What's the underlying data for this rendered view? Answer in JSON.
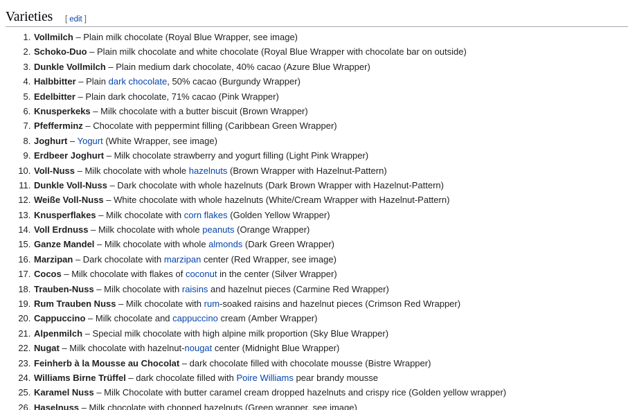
{
  "section": {
    "title": "Varieties",
    "edit_open": "[",
    "edit_label": "edit",
    "edit_close": "]"
  },
  "items": [
    {
      "name": "Vollmilch",
      "parts": [
        {
          "t": " – Plain milk chocolate (Royal Blue Wrapper, see image)"
        }
      ]
    },
    {
      "name": "Schoko-Duo",
      "parts": [
        {
          "t": " – Plain milk chocolate and white chocolate (Royal Blue Wrapper with chocolate bar on outside)"
        }
      ]
    },
    {
      "name": "Dunkle Vollmilch",
      "parts": [
        {
          "t": " – Plain medium dark chocolate, 40% cacao (Azure Blue Wrapper)"
        }
      ]
    },
    {
      "name": "Halbbitter",
      "parts": [
        {
          "t": " – Plain "
        },
        {
          "t": "dark chocolate",
          "link": true
        },
        {
          "t": ", 50% cacao (Burgundy Wrapper)"
        }
      ]
    },
    {
      "name": "Edelbitter",
      "parts": [
        {
          "t": " – Plain dark chocolate, 71% cacao (Pink Wrapper)"
        }
      ]
    },
    {
      "name": "Knusperkeks",
      "parts": [
        {
          "t": " – Milk chocolate with a butter biscuit (Brown Wrapper)"
        }
      ]
    },
    {
      "name": "Pfefferminz",
      "parts": [
        {
          "t": " – Chocolate with peppermint filling (Caribbean Green Wrapper)"
        }
      ]
    },
    {
      "name": "Joghurt",
      "parts": [
        {
          "t": " – "
        },
        {
          "t": "Yogurt",
          "link": true
        },
        {
          "t": " (White Wrapper, see image)"
        }
      ]
    },
    {
      "name": "Erdbeer Joghurt",
      "parts": [
        {
          "t": " – Milk chocolate strawberry and yogurt filling (Light Pink Wrapper)"
        }
      ]
    },
    {
      "name": "Voll-Nuss",
      "parts": [
        {
          "t": " – Milk chocolate with whole "
        },
        {
          "t": "hazelnuts",
          "link": true
        },
        {
          "t": " (Brown Wrapper with Hazelnut-Pattern)"
        }
      ]
    },
    {
      "name": "Dunkle Voll-Nuss",
      "parts": [
        {
          "t": " – Dark chocolate with whole hazelnuts (Dark Brown Wrapper with Hazelnut-Pattern)"
        }
      ]
    },
    {
      "name": "Weiße Voll-Nuss",
      "parts": [
        {
          "t": " – White chocolate with whole hazelnuts (White/Cream Wrapper with Hazelnut-Pattern)"
        }
      ]
    },
    {
      "name": "Knusperflakes",
      "parts": [
        {
          "t": " – Milk chocolate with "
        },
        {
          "t": "corn flakes",
          "link": true
        },
        {
          "t": " (Golden Yellow Wrapper)"
        }
      ]
    },
    {
      "name": "Voll Erdnuss",
      "parts": [
        {
          "t": " – Milk chocolate with whole "
        },
        {
          "t": "peanuts",
          "link": true
        },
        {
          "t": " (Orange Wrapper)"
        }
      ]
    },
    {
      "name": "Ganze Mandel",
      "parts": [
        {
          "t": " – Milk chocolate with whole "
        },
        {
          "t": "almonds",
          "link": true
        },
        {
          "t": " (Dark Green Wrapper)"
        }
      ]
    },
    {
      "name": "Marzipan",
      "parts": [
        {
          "t": " – Dark chocolate with "
        },
        {
          "t": "marzipan",
          "link": true
        },
        {
          "t": " center (Red Wrapper, see image)"
        }
      ]
    },
    {
      "name": "Cocos",
      "parts": [
        {
          "t": " – Milk chocolate with flakes of "
        },
        {
          "t": "coconut",
          "link": true
        },
        {
          "t": " in the center (Silver Wrapper)"
        }
      ]
    },
    {
      "name": "Trauben-Nuss",
      "parts": [
        {
          "t": " – Milk chocolate with "
        },
        {
          "t": "raisins",
          "link": true
        },
        {
          "t": " and hazelnut pieces (Carmine Red Wrapper)"
        }
      ]
    },
    {
      "name": "Rum Trauben Nuss",
      "parts": [
        {
          "t": " – Milk chocolate with "
        },
        {
          "t": "rum",
          "link": true
        },
        {
          "t": "-soaked raisins and hazelnut pieces (Crimson Red Wrapper)"
        }
      ]
    },
    {
      "name": "Cappuccino",
      "parts": [
        {
          "t": " – Milk chocolate and "
        },
        {
          "t": "cappuccino",
          "link": true
        },
        {
          "t": " cream (Amber Wrapper)"
        }
      ]
    },
    {
      "name": "Alpenmilch",
      "parts": [
        {
          "t": " – Special milk chocolate with high alpine milk proportion (Sky Blue Wrapper)"
        }
      ]
    },
    {
      "name": "Nugat",
      "parts": [
        {
          "t": " – Milk chocolate with hazelnut-"
        },
        {
          "t": "nougat",
          "link": true
        },
        {
          "t": " center (Midnight Blue Wrapper)"
        }
      ]
    },
    {
      "name": "Feinherb à la Mousse au Chocolat",
      "parts": [
        {
          "t": " – dark chocolate filled with chocolate mousse (Bistre Wrapper)"
        }
      ]
    },
    {
      "name": "Williams Birne Trüffel",
      "parts": [
        {
          "t": " – dark chocolate filled with "
        },
        {
          "t": "Poire Williams",
          "link": true
        },
        {
          "t": " pear brandy mousse"
        }
      ]
    },
    {
      "name": "Karamel Nuss",
      "parts": [
        {
          "t": " – Milk Chocolate with butter caramel cream dropped hazelnuts and crispy rice (Golden yellow wrapper)"
        }
      ]
    },
    {
      "name": "Haselnuss",
      "parts": [
        {
          "t": " – Milk chocolate with chopped hazelnuts (Green wrapper, see image)"
        }
      ]
    }
  ]
}
